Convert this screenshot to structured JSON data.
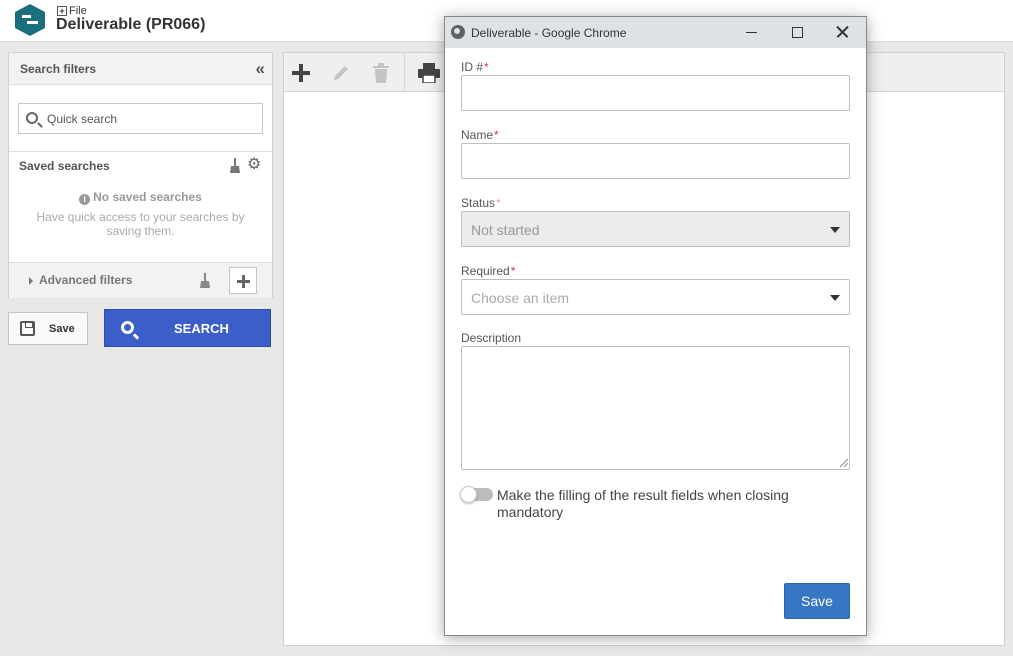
{
  "header": {
    "file_link": "File",
    "title": "Deliverable (PR066)"
  },
  "filters": {
    "title": "Search filters",
    "quick_search_placeholder": "Quick search",
    "saved_searches_title": "Saved searches",
    "no_saved_searches": "No saved searches",
    "saved_hint": "Have quick access to your searches by saving them.",
    "advanced_filters_label": "Advanced filters",
    "save_label": "Save",
    "search_label": "SEARCH"
  },
  "toolbar": {
    "icons": [
      "add-icon",
      "edit-icon",
      "delete-icon",
      "print-icon"
    ]
  },
  "popup": {
    "window_title": "Deliverable - Google Chrome",
    "fields": {
      "id": {
        "label": "ID #",
        "required_mark": "*",
        "value": ""
      },
      "name": {
        "label": "Name",
        "required_mark": "*",
        "value": ""
      },
      "status": {
        "label": "Status",
        "required_mark": "*",
        "value": "Not started"
      },
      "required": {
        "label": "Required",
        "required_mark": "*",
        "placeholder": "Choose an item"
      },
      "description": {
        "label": "Description",
        "value": ""
      }
    },
    "toggle_label": "Make the filling of the result fields when closing mandatory",
    "toggle_on": false,
    "save_label": "Save"
  },
  "colors": {
    "primary_button": "#3b5ec9",
    "save_button": "#3677c4",
    "required_mark": "#d9363e",
    "logo": "#1b6e7c"
  }
}
